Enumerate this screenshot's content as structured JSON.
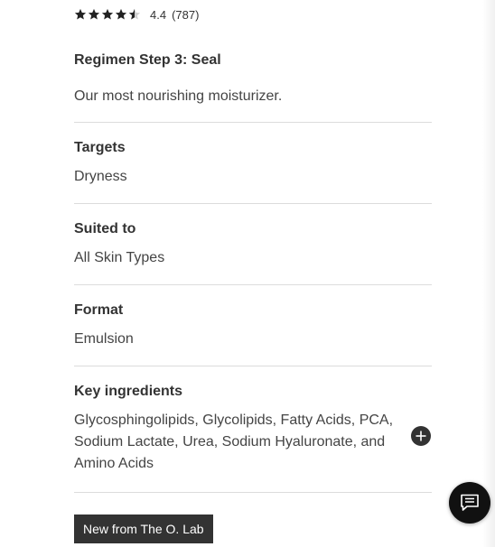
{
  "product": {
    "rating": {
      "value": "4.4",
      "stars_filled": 4.4,
      "stars_total": 5,
      "count": "(787)"
    },
    "regimen": "Regimen Step 3: Seal",
    "description": "Our most nourishing moisturizer."
  },
  "details": [
    {
      "label": "Targets",
      "value": "Dryness"
    },
    {
      "label": "Suited to",
      "value": "All Skin Types"
    },
    {
      "label": "Format",
      "value": "Emulsion"
    },
    {
      "label": "Key ingredients",
      "value": "Glycosphingolipids, Glycolipids, Fatty Acids, PCA, Sodium Lactate, Urea, Sodium Hyaluronate, and Amino Acids"
    }
  ],
  "badge": "New from The O. Lab",
  "icons": {
    "expand": "plus-circle-icon",
    "chat": "chat-icon",
    "star": "star-icon"
  },
  "colors": {
    "text": "#333333",
    "divider": "#dcdcdc",
    "badge_bg": "#333333",
    "chat_bg": "#111111"
  }
}
